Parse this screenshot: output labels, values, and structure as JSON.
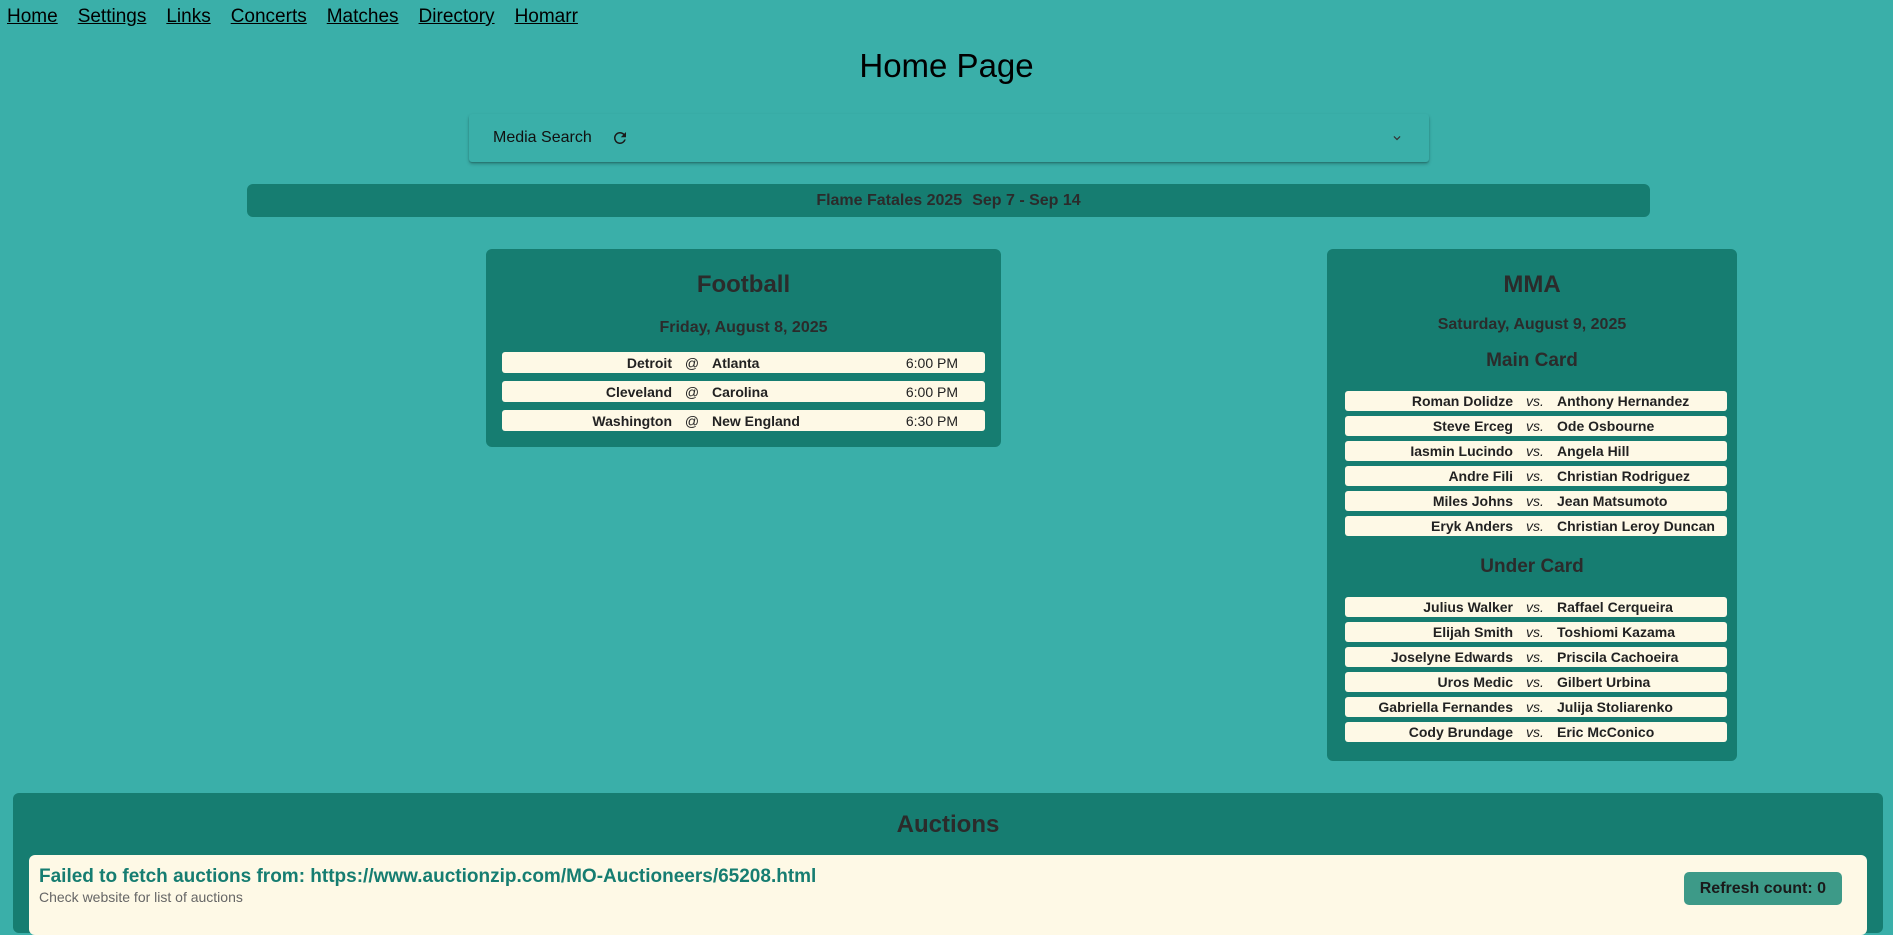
{
  "nav": [
    "Home",
    "Settings",
    "Links",
    "Concerts",
    "Matches",
    "Directory",
    "Homarr"
  ],
  "page_title": "Home Page",
  "media_search": {
    "label": "Media Search",
    "icons": [
      "refresh-icon",
      "chevron-down-icon"
    ]
  },
  "event_banner": {
    "name": "Flame Fatales 2025",
    "dates": "Sep 7 - Sep 14"
  },
  "football": {
    "title": "Football",
    "date": "Friday, August 8, 2025",
    "games": [
      {
        "away": "Detroit",
        "sep": "@",
        "home": "Atlanta",
        "time": "6:00 PM"
      },
      {
        "away": "Cleveland",
        "sep": "@",
        "home": "Carolina",
        "time": "6:00 PM"
      },
      {
        "away": "Washington",
        "sep": "@",
        "home": "New England",
        "time": "6:30 PM"
      }
    ]
  },
  "mma": {
    "title": "MMA",
    "date": "Saturday, August 9, 2025",
    "main_card_title": "Main Card",
    "main_card": [
      {
        "f1": "Roman Dolidze",
        "vs": "vs.",
        "f2": "Anthony Hernandez"
      },
      {
        "f1": "Steve Erceg",
        "vs": "vs.",
        "f2": "Ode Osbourne"
      },
      {
        "f1": "Iasmin Lucindo",
        "vs": "vs.",
        "f2": "Angela Hill"
      },
      {
        "f1": "Andre Fili",
        "vs": "vs.",
        "f2": "Christian Rodriguez"
      },
      {
        "f1": "Miles Johns",
        "vs": "vs.",
        "f2": "Jean Matsumoto"
      },
      {
        "f1": "Eryk Anders",
        "vs": "vs.",
        "f2": "Christian Leroy Duncan"
      }
    ],
    "under_card_title": "Under Card",
    "under_card": [
      {
        "f1": "Julius Walker",
        "vs": "vs.",
        "f2": "Raffael Cerqueira"
      },
      {
        "f1": "Elijah Smith",
        "vs": "vs.",
        "f2": "Toshiomi Kazama"
      },
      {
        "f1": "Joselyne Edwards",
        "vs": "vs.",
        "f2": "Priscila Cachoeira"
      },
      {
        "f1": "Uros Medic",
        "vs": "vs.",
        "f2": "Gilbert Urbina"
      },
      {
        "f1": "Gabriella Fernandes",
        "vs": "vs.",
        "f2": "Julija Stoliarenko"
      },
      {
        "f1": "Cody Brundage",
        "vs": "vs.",
        "f2": "Eric McConico"
      }
    ]
  },
  "auctions": {
    "title": "Auctions",
    "error": "Failed to fetch auctions from: https://www.auctionzip.com/MO-Auctioneers/65208.html",
    "hint": "Check website for list of auctions",
    "refresh_count": "Refresh count: 0"
  }
}
